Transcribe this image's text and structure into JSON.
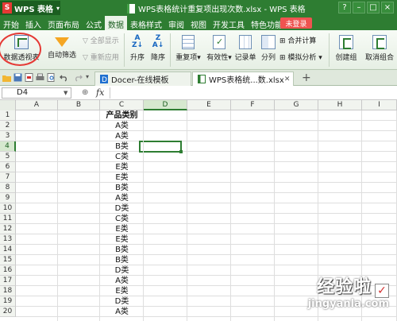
{
  "titlebar": {
    "app_name": "WPS 表格",
    "logo_letter": "S",
    "window_title": "WPS表格统计重复项出现次数.xlsx - WPS 表格",
    "controls": [
      "?",
      "–",
      "□",
      "×"
    ]
  },
  "menubar": {
    "items": [
      "开始",
      "插入",
      "页面布局",
      "公式",
      "数据",
      "表格样式",
      "审阅",
      "视图",
      "开发工具",
      "特色功能"
    ],
    "active": "数据",
    "login_label": "未登录"
  },
  "ribbon": {
    "pivot_label": "数据透视表",
    "autofilter_label": "自动筛选",
    "show_all_label": "全部显示",
    "reapply_label": "重新应用",
    "sort_asc_label": "升序",
    "sort_desc_label": "降序",
    "duplicates_label": "重复项",
    "validation_label": "有效性",
    "record_form_label": "记录单",
    "split_label": "分列",
    "merge_calc_label": "合并计算",
    "whatif_label": "模拟分析",
    "group_label": "创建组",
    "ungroup_label": "取消组合"
  },
  "tabs": {
    "docer_label": "Docer-在线模板",
    "file_label": "WPS表格统...数.xlsx"
  },
  "formula": {
    "name_box": "D4",
    "fx_label": "fx",
    "value": ""
  },
  "grid": {
    "columns": [
      "A",
      "B",
      "C",
      "D",
      "E",
      "F",
      "G",
      "H",
      "I"
    ],
    "selected_column": "D",
    "rows": [
      "1",
      "2",
      "3",
      "4",
      "5",
      "6",
      "7",
      "8",
      "9",
      "10",
      "11",
      "12",
      "13",
      "14",
      "15",
      "16",
      "17",
      "18",
      "19",
      "20"
    ],
    "selected_row": "4",
    "column_c": [
      "产品类别",
      "A类",
      "A类",
      "B类",
      "C类",
      "E类",
      "E类",
      "B类",
      "A类",
      "D类",
      "C类",
      "E类",
      "E类",
      "B类",
      "B类",
      "D类",
      "A类",
      "E类",
      "D类",
      "A类"
    ]
  },
  "watermark": {
    "text": "经验啦",
    "url": "jingyanla.com"
  }
}
